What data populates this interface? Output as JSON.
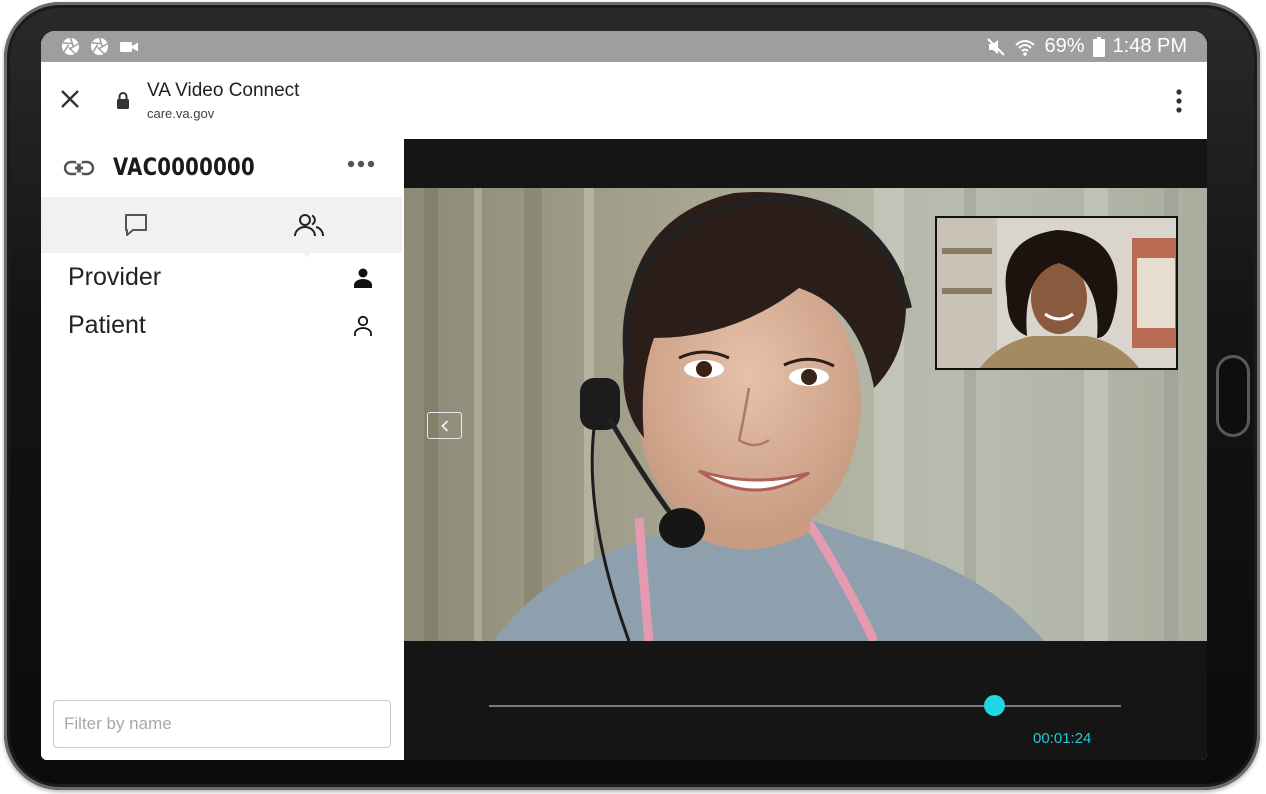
{
  "status_bar": {
    "battery": "69%",
    "time": "1:48 PM",
    "icons": [
      "aperture-icon",
      "aperture-icon",
      "video-camera-icon",
      "mute-icon",
      "wifi-icon",
      "battery-icon"
    ]
  },
  "browser": {
    "title": "VA Video Connect",
    "url": "care.va.gov"
  },
  "sidebar": {
    "room_id": "VAC0000000",
    "tabs": [
      {
        "icon": "chat-icon",
        "selected": false
      },
      {
        "icon": "participants-icon",
        "selected": true
      }
    ],
    "participants": [
      {
        "name": "Provider",
        "icon": "person-filled-icon"
      },
      {
        "name": "Patient",
        "icon": "person-outline-icon"
      }
    ],
    "filter_placeholder": "Filter by name"
  },
  "player": {
    "elapsed": "00:01:24",
    "progress": 0.8,
    "accent_color": "#1fd7e4"
  }
}
